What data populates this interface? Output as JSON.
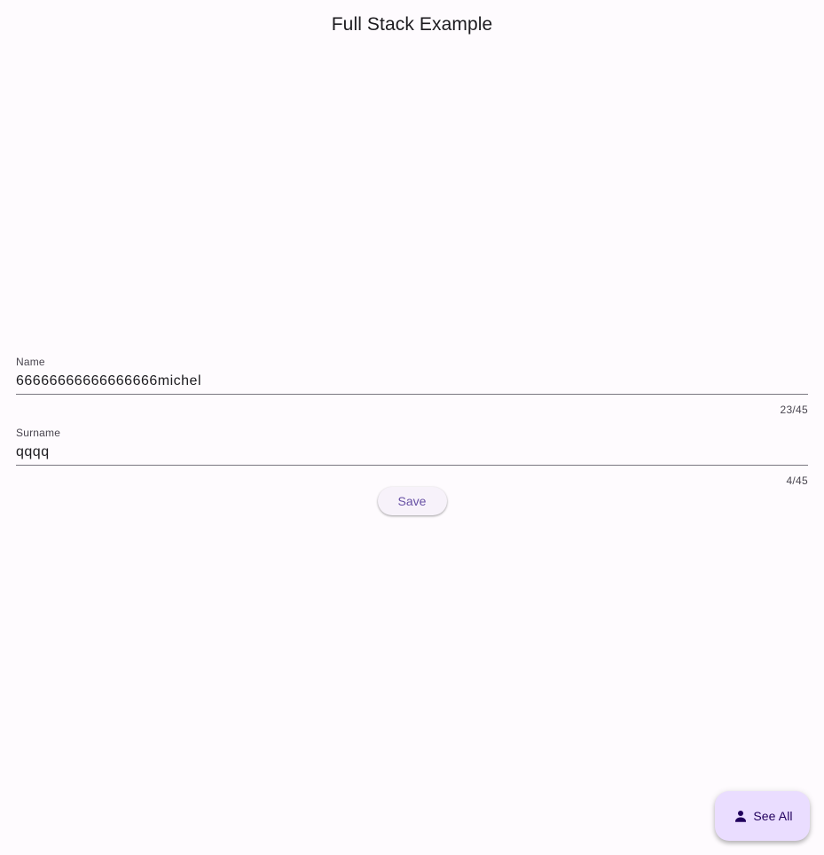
{
  "app_bar": {
    "title": "Full Stack Example"
  },
  "form": {
    "name_field": {
      "label": "Name",
      "value": "66666666666666666michel",
      "counter": "23/45"
    },
    "surname_field": {
      "label": "Surname",
      "value": "qqqq",
      "counter": "4/45"
    },
    "save_label": "Save"
  },
  "fab": {
    "label": "See All",
    "icon": "person-icon"
  },
  "colors": {
    "background": "#fefbfe",
    "primary": "#6750a4",
    "fab_background": "#eaddff",
    "fab_text": "#21005d"
  }
}
